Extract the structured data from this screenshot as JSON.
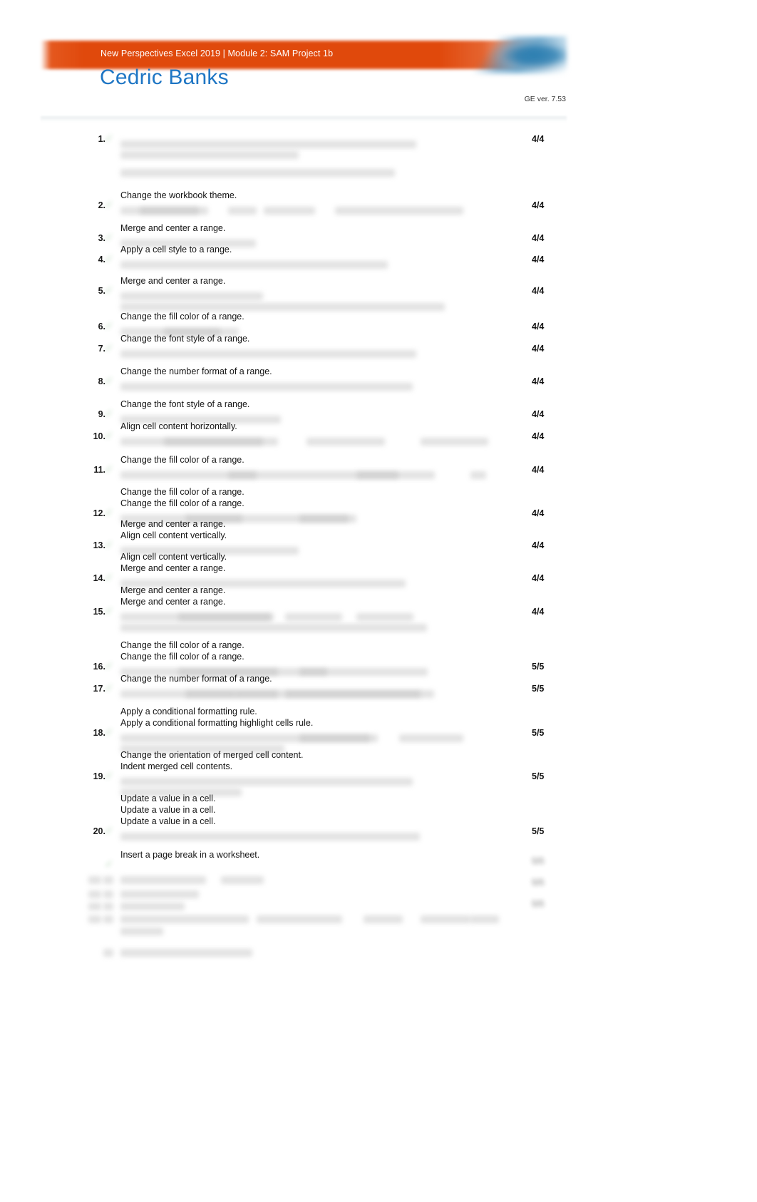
{
  "header": {
    "banner_title": "New Perspectives Excel 2019 | Module 2: SAM Project 1b",
    "student_name": "Cedric Banks",
    "student_meta": "",
    "ge_version": "GE ver. 7.53",
    "brand_orange": "#e0490c",
    "brand_blue": "#1f76c4",
    "logo_icon": "sam-logo-icon"
  },
  "tasks": [
    {
      "number": "1.",
      "score": "4/4",
      "labels": []
    },
    {
      "number": "2.",
      "score": "4/4",
      "labels": [
        "Change the workbook theme."
      ]
    },
    {
      "number": "3.",
      "score": "4/4",
      "labels": [
        "Merge and center a range."
      ]
    },
    {
      "number": "4.",
      "score": "4/4",
      "labels": [
        "Apply a cell style to a range."
      ]
    },
    {
      "number": "5.",
      "score": "4/4",
      "labels": [
        "Merge and center a range."
      ]
    },
    {
      "number": "6.",
      "score": "4/4",
      "labels": [
        "Change the fill color of a range."
      ]
    },
    {
      "number": "7.",
      "score": "4/4",
      "labels": [
        "Change the font style of a range."
      ]
    },
    {
      "number": "8.",
      "score": "4/4",
      "labels": [
        "Change the number format of a range."
      ]
    },
    {
      "number": "9.",
      "score": "4/4",
      "labels": [
        "Change the font style of a range."
      ]
    },
    {
      "number": "10.",
      "score": "4/4",
      "labels": [
        "Align cell content horizontally."
      ]
    },
    {
      "number": "11.",
      "score": "4/4",
      "labels": [
        "Change the fill color of a range."
      ]
    },
    {
      "number": "12.",
      "score": "4/4",
      "labels": [
        "Change the fill color of a range.",
        "Change the fill color of a range."
      ]
    },
    {
      "number": "13.",
      "score": "4/4",
      "labels": [
        "Merge and center a range.",
        "Align cell content vertically."
      ]
    },
    {
      "number": "14.",
      "score": "4/4",
      "labels": [
        "Align cell content vertically.",
        "Merge and center a range."
      ]
    },
    {
      "number": "15.",
      "score": "4/4",
      "labels": [
        "Merge and center a range.",
        "Merge and center a range."
      ]
    },
    {
      "number": "16.",
      "score": "5/5",
      "labels": [
        "Change the fill color of a range.",
        "Change the fill color of a range."
      ]
    },
    {
      "number": "17.",
      "score": "5/5",
      "labels": [
        "Change the number format of a range."
      ]
    },
    {
      "number": "18.",
      "score": "5/5",
      "labels": [
        "Apply a conditional formatting rule.",
        "Apply a conditional formatting highlight cells rule."
      ]
    },
    {
      "number": "19.",
      "score": "5/5",
      "labels": [
        "Change the orientation of merged cell content.",
        "Indent merged cell contents."
      ]
    },
    {
      "number": "20.",
      "score": "5/5",
      "labels": [
        "Update a value in a cell.",
        "Update a value in a cell.",
        "Update a value in a cell."
      ]
    },
    {
      "number": "",
      "score": "",
      "labels": [
        "Insert a page break in a worksheet."
      ]
    }
  ]
}
